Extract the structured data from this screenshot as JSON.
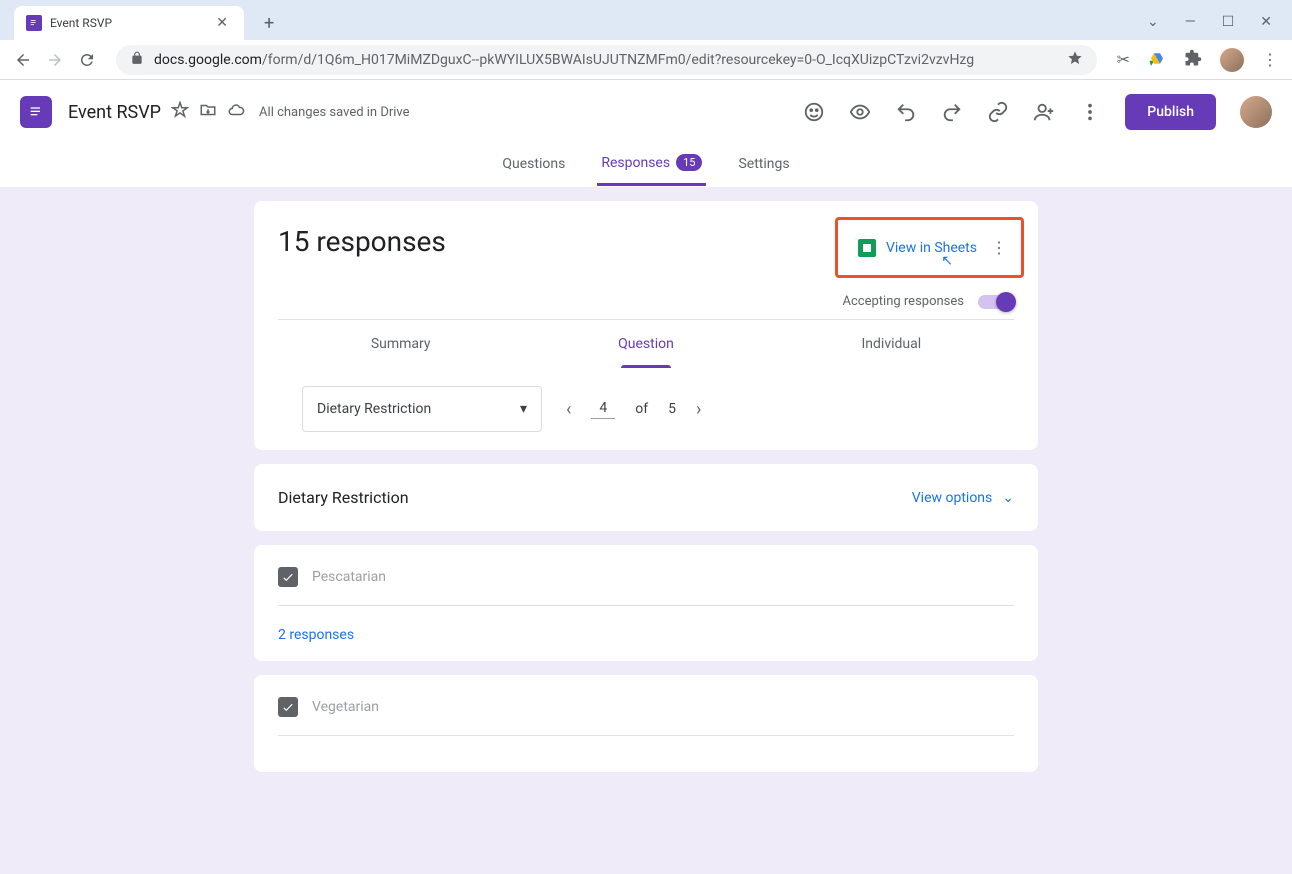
{
  "browser": {
    "tab_title": "Event RSVP",
    "url_domain": "docs.google.com",
    "url_path": "/form/d/1Q6m_H017MiMZDguxC--pkWYILUX5BWAIsUJUTNZMFm0/edit?resourcekey=0-O_IcqXUizpCTzvi2vzvHzg"
  },
  "header": {
    "doc_title": "Event RSVP",
    "save_status": "All changes saved in Drive",
    "publish_label": "Publish"
  },
  "mainTabs": {
    "questions": "Questions",
    "responses": "Responses",
    "responses_badge": "15",
    "settings": "Settings"
  },
  "responses": {
    "count_text": "15 responses",
    "view_in_sheets": "View in Sheets",
    "accepting_label": "Accepting responses"
  },
  "subTabs": {
    "summary": "Summary",
    "question": "Question",
    "individual": "Individual"
  },
  "pager": {
    "selected_question": "Dietary Restriction",
    "current": "4",
    "of_label": "of",
    "total": "5"
  },
  "questionCard": {
    "title": "Dietary Restriction",
    "view_options": "View options"
  },
  "answers": [
    {
      "label": "Pescatarian",
      "count_text": "2 responses"
    },
    {
      "label": "Vegetarian"
    }
  ]
}
